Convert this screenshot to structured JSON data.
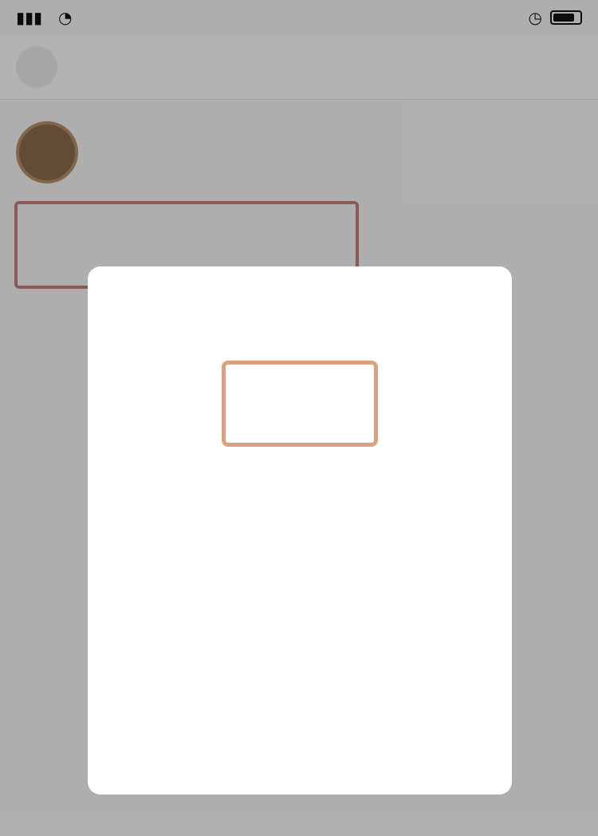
{
  "status_bar": {
    "carrier": "",
    "time": "",
    "battery_level": 0.8
  },
  "nav": {
    "title": "",
    "action_label": ""
  },
  "post": {
    "author": "",
    "tag": "",
    "content": "",
    "sub": ""
  },
  "dialog": {
    "title": "",
    "options": [
      {
        "label": ""
      },
      {
        "label": ""
      },
      {
        "label": ""
      },
      {
        "label": ""
      },
      {
        "label": ""
      }
    ],
    "cancel_label": ""
  },
  "colors": {
    "option": "#3a86e8",
    "cancel": "#e8734a",
    "highlight": "#d9a37e"
  }
}
